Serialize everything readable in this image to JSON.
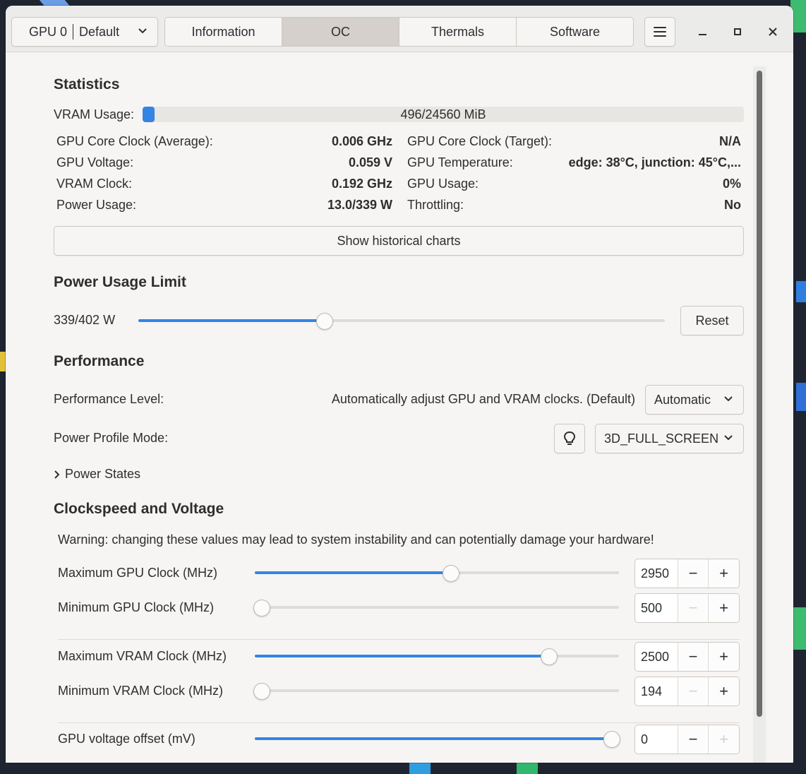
{
  "header": {
    "gpu_selector": {
      "label": "GPU 0",
      "profile": "Default"
    },
    "tabs": [
      {
        "label": "Information",
        "active": false
      },
      {
        "label": "OC",
        "active": true
      },
      {
        "label": "Thermals",
        "active": false
      },
      {
        "label": "Software",
        "active": false
      }
    ],
    "menu_icon": "hamburger-menu-icon",
    "window_controls": [
      "minimize-icon",
      "maximize-icon",
      "close-icon"
    ]
  },
  "statistics": {
    "title": "Statistics",
    "vram_label": "VRAM Usage:",
    "vram_text": "496/24560 MiB",
    "vram_used": 496,
    "vram_total": 24560,
    "rows": [
      {
        "label": "GPU Core Clock (Average):",
        "value": "0.006 GHz"
      },
      {
        "label": "GPU Voltage:",
        "value": "0.059 V"
      },
      {
        "label": "VRAM Clock:",
        "value": "0.192 GHz"
      },
      {
        "label": "Power Usage:",
        "value": "13.0/339 W"
      }
    ],
    "rows_right": [
      {
        "label": "GPU Core Clock (Target):",
        "value": "N/A"
      },
      {
        "label": "GPU Temperature:",
        "value": "edge: 38°C, junction: 45°C,..."
      },
      {
        "label": "GPU Usage:",
        "value": "0%"
      },
      {
        "label": "Throttling:",
        "value": "No"
      }
    ],
    "historical_button": "Show historical charts"
  },
  "power_limit": {
    "title": "Power Usage Limit",
    "value_text": "339/402 W",
    "current": 339,
    "max": 402,
    "slider_fraction": 0.35,
    "reset_label": "Reset"
  },
  "performance": {
    "title": "Performance",
    "level_label": "Performance Level:",
    "level_desc": "Automatically adjust GPU and VRAM clocks. (Default)",
    "level_value": "Automatic",
    "profile_label": "Power Profile Mode:",
    "profile_value": "3D_FULL_SCREEN",
    "power_states_label": "Power States"
  },
  "clocks": {
    "title": "Clockspeed and Voltage",
    "warning": "Warning: changing these values may lead to system instability and can potentially damage your hardware!",
    "items": [
      {
        "label": "Maximum GPU Clock (MHz)",
        "value": "2950",
        "fraction": 0.54,
        "minus_enabled": true,
        "plus_enabled": true
      },
      {
        "label": "Minimum GPU Clock (MHz)",
        "value": "500",
        "fraction": 0.0,
        "minus_enabled": false,
        "plus_enabled": true
      },
      {
        "label": "Maximum VRAM Clock (MHz)",
        "value": "2500",
        "fraction": 0.82,
        "minus_enabled": true,
        "plus_enabled": true
      },
      {
        "label": "Minimum VRAM Clock (MHz)",
        "value": "194",
        "fraction": 0.0,
        "minus_enabled": false,
        "plus_enabled": true
      },
      {
        "label": "GPU voltage offset (mV)",
        "value": "0",
        "fraction": 1.0,
        "minus_enabled": true,
        "plus_enabled": false
      }
    ]
  },
  "colors": {
    "accent": "#3584e4",
    "window_bg": "#f6f5f4",
    "header_bg": "#ebebea"
  }
}
